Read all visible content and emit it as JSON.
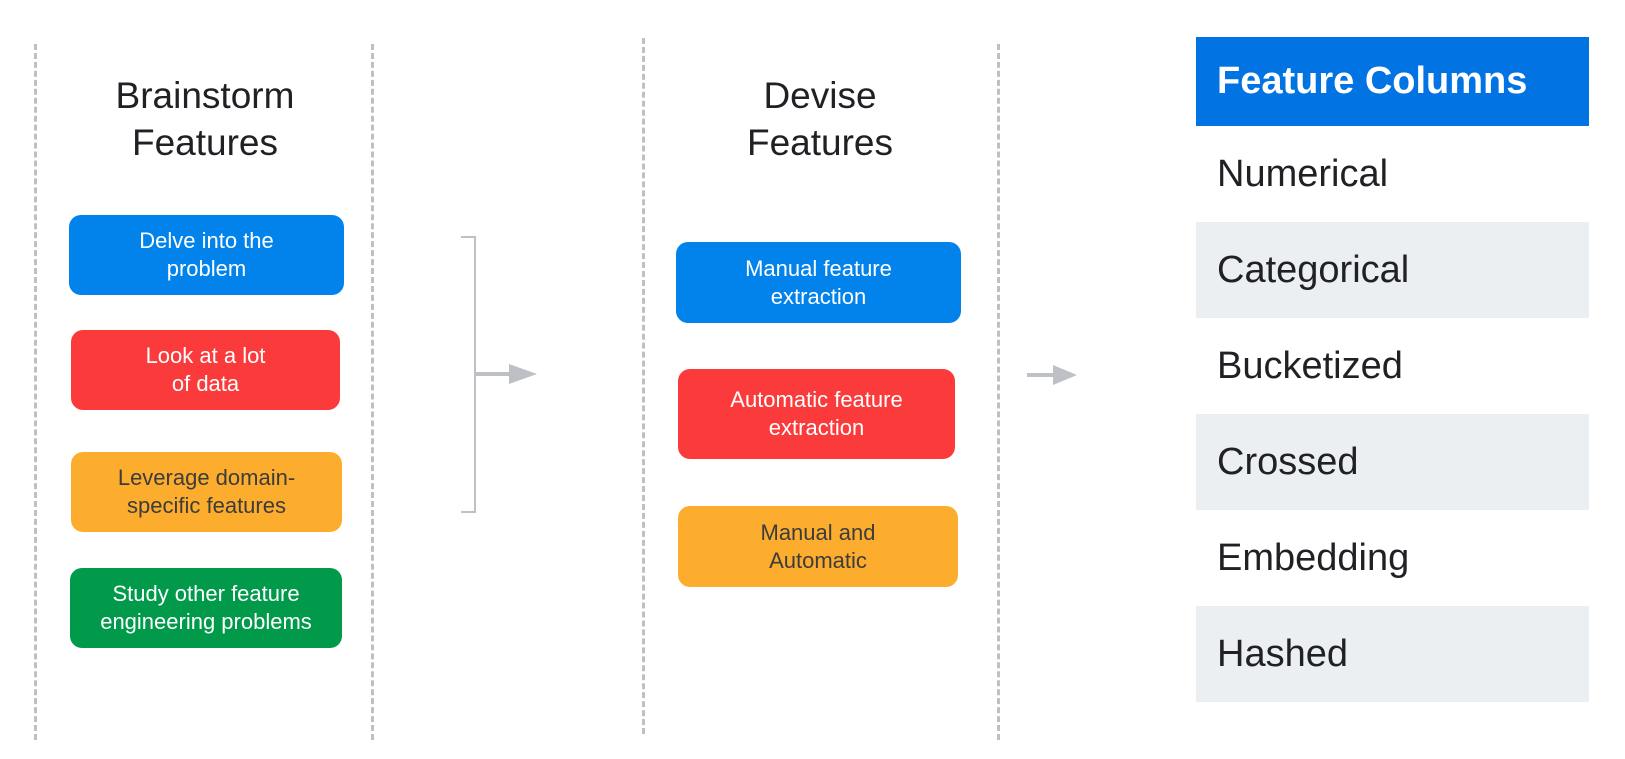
{
  "colors": {
    "blue": "#0283ec",
    "red": "#fb3b3b",
    "yellow": "#fdad2d",
    "green": "#009a4a",
    "header_blue": "#0173e2",
    "row_shade": "#eceff1",
    "line_gray": "#bdc1c6"
  },
  "brainstorm": {
    "title_line1": "Brainstorm",
    "title_line2": "Features",
    "items": [
      {
        "line1": "Delve into the",
        "line2": "problem",
        "color": "blue"
      },
      {
        "line1": "Look at a lot",
        "line2": "of data",
        "color": "red"
      },
      {
        "line1": "Leverage domain-",
        "line2": "specific features",
        "color": "yellow"
      },
      {
        "line1": "Study other feature",
        "line2": "engineering problems",
        "color": "green"
      }
    ]
  },
  "devise": {
    "title_line1": "Devise",
    "title_line2": "Features",
    "items": [
      {
        "line1": "Manual feature",
        "line2": "extraction",
        "color": "blue"
      },
      {
        "line1": "Automatic feature",
        "line2": "extraction",
        "color": "red"
      },
      {
        "line1": "Manual and",
        "line2": "Automatic",
        "color": "yellow"
      }
    ]
  },
  "feature_columns": {
    "header": "Feature Columns",
    "rows": [
      "Numerical",
      "Categorical",
      "Bucketized",
      "Crossed",
      "Embedding",
      "Hashed"
    ]
  }
}
